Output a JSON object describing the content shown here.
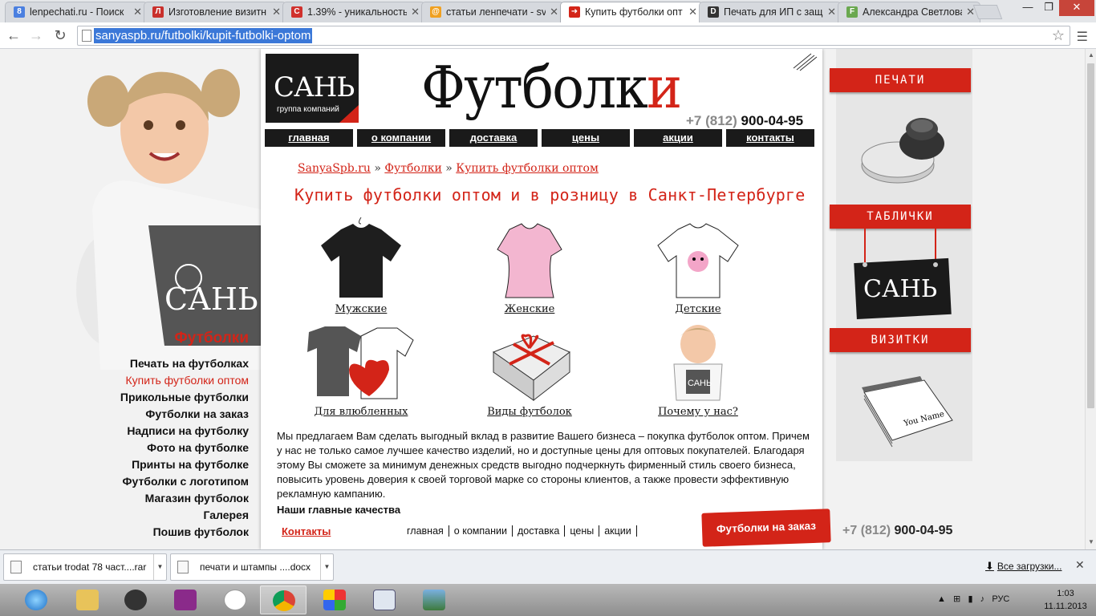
{
  "browser": {
    "tabs": [
      {
        "title": "lenpechati.ru - Поиск",
        "fav_color": "#4a7fe0",
        "fav": "8",
        "active": false
      },
      {
        "title": "Изготовление визитн",
        "fav_color": "#c9302c",
        "fav": "Л",
        "active": false
      },
      {
        "title": "1.39% - уникальность",
        "fav_color": "#d0312d",
        "fav": "C",
        "active": false
      },
      {
        "title": "статьи ленпечати - sv",
        "fav_color": "#f0a020",
        "fav": "@",
        "active": false
      },
      {
        "title": "Купить футболки опт",
        "fav_color": "#d32418",
        "fav": "➜",
        "active": true
      },
      {
        "title": "Печать для ИП с защ",
        "fav_color": "#333333",
        "fav": "D",
        "active": false
      },
      {
        "title": "Александра Светлова",
        "fav_color": "#6aa84f",
        "fav": "F",
        "active": false
      }
    ],
    "url": "sanyaspb.ru/futbolki/kupit-futbolki-optom"
  },
  "site": {
    "logo_big": "САНЬ",
    "logo_small": "группа компаний",
    "header_title_main": "Футболк",
    "header_title_accent": "и",
    "phone_code": "+7 (812)",
    "phone_number": "900-04-95",
    "topnav": [
      "главная",
      "о компании",
      "доставка",
      "цены",
      "акции",
      "контакты"
    ],
    "breadcrumbs": [
      "SanyaSpb.ru",
      "Футболки",
      "Купить футболки оптом"
    ],
    "page_heading": "Купить футболки оптом и в розницу в Санкт-Петербурге",
    "categories": [
      "Мужские",
      "Женские",
      "Детские",
      "Для влюбленных",
      "Виды футболок",
      "Почему у нас?"
    ],
    "paragraph": "Мы предлагаем Вам сделать выгодный вклад в развитие Вашего бизнеса – покупка футболок оптом. Причем у нас не только самое лучшее качество изделий, но и доступные цены для оптовых покупателей. Благодаря этому Вы сможете за минимум денежных средств выгодно подчеркнуть фирменный стиль своего бизнеса, повысить уровень доверия к своей торговой марке со стороны клиентов, а также провести эффективную рекламную кампанию.",
    "subheading": "Наши главные качества",
    "contacts_link": "Контакты",
    "footer_nav": [
      "главная",
      "о компании",
      "доставка",
      "цены",
      "акции"
    ],
    "order_button": "Футболки на заказ"
  },
  "sidebar": {
    "title": "Футболки",
    "items": [
      "Печать на футболках",
      "Купить футболки оптом",
      "Прикольные футболки",
      "Футболки на заказ",
      "Надписи на футболку",
      "Фото на футболке",
      "Принты на футболке",
      "Футболки с логотипом",
      "Магазин футболок",
      "Галерея",
      "Пошив футболок"
    ]
  },
  "right_panel": {
    "ribbons": [
      "ПЕЧАТИ",
      "ТАБЛИЧКИ",
      "ВИЗИТКИ"
    ],
    "plaque_text": "САНЬ",
    "card_text": "You Name"
  },
  "downloads": {
    "items": [
      "статьи trodat 78 част....rar",
      "печати и штампы ....docx"
    ],
    "all_label": "Все загрузки..."
  },
  "taskbar": {
    "lang": "РУС",
    "time": "1:03",
    "date": "11.11.2013"
  },
  "colors": {
    "accent": "#d32418",
    "dark": "#1a1a1a"
  }
}
